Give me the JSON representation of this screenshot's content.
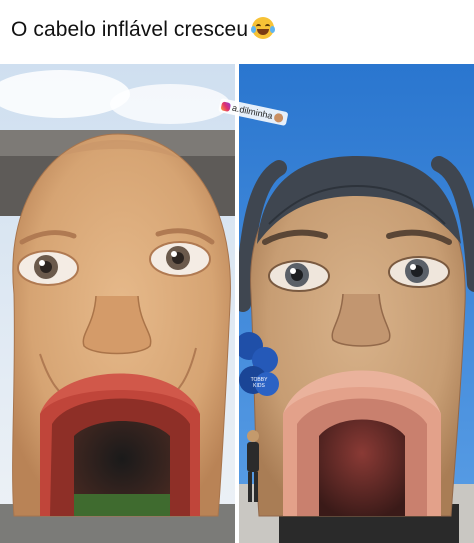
{
  "caption": {
    "text": "O cabelo inflável cresceu",
    "emoji": "face-with-tears-of-joy"
  },
  "watermark": {
    "text": "a.dilminha"
  },
  "balloon_text": "TOBBY\nKIDS",
  "colors": {
    "skin_left": "#d9a877",
    "skin_right": "#c9a078",
    "hair_right": "#3f4650",
    "mouth_left": "#c0453a",
    "mouth_right": "#e3a18a",
    "sky_right": "#2f7fd3",
    "balloons": "#1f4fa8"
  }
}
